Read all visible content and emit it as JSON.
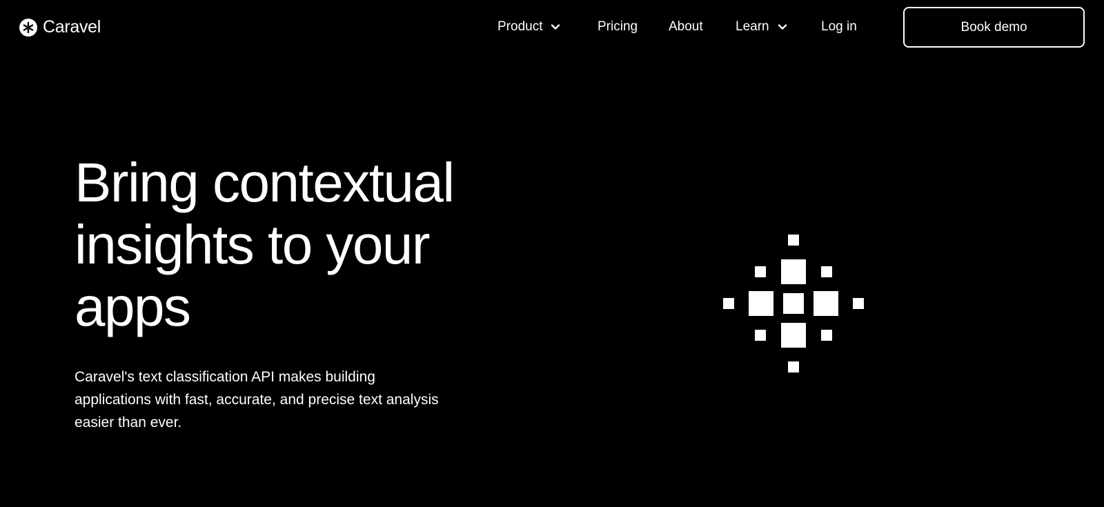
{
  "brand": {
    "name": "Caravel",
    "icon": "asterisk-circle-icon"
  },
  "nav": {
    "items": [
      {
        "label": "Product",
        "has_dropdown": true
      },
      {
        "label": "Pricing",
        "has_dropdown": false
      },
      {
        "label": "About",
        "has_dropdown": false
      },
      {
        "label": "Learn",
        "has_dropdown": true
      },
      {
        "label": "Log in",
        "has_dropdown": false
      }
    ],
    "cta_label": "Book demo"
  },
  "hero": {
    "title_lines": [
      "Bring contextual",
      "insights to your",
      "apps"
    ],
    "subtitle_lines": [
      "Caravel's text classification API makes building",
      "applications with fast, accurate, and precise text analysis",
      "easier than ever."
    ],
    "graphic_icon": "pixel-diamond-graphic"
  },
  "colors": {
    "background": "#000000",
    "foreground": "#ffffff"
  }
}
